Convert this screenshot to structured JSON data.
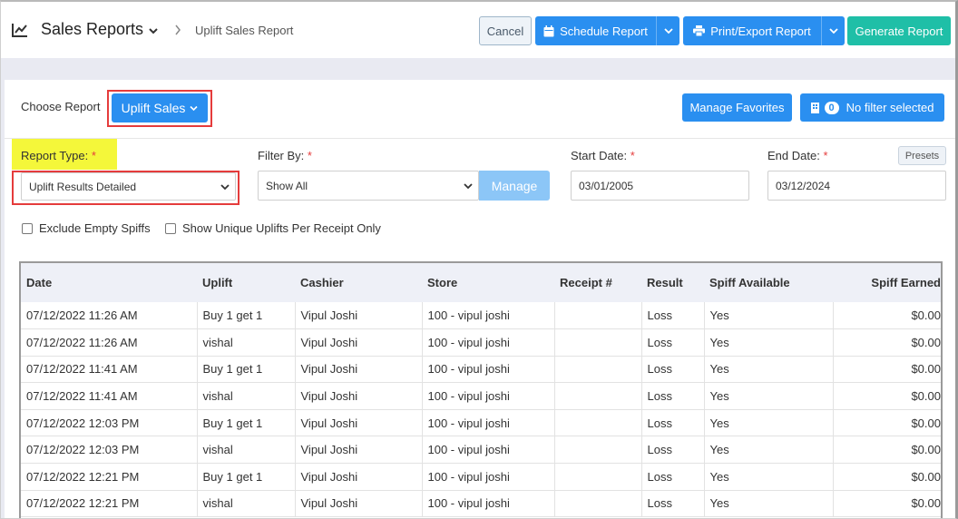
{
  "header": {
    "title": "Sales Reports",
    "breadcrumb": "Uplift Sales Report",
    "icon": "line-chart-icon"
  },
  "toolbar": {
    "cancel_label": "Cancel",
    "schedule_label": "Schedule Report",
    "print_label": "Print/Export Report",
    "generate_label": "Generate Report"
  },
  "report": {
    "choose_label": "Choose Report",
    "selected": "Uplift Sales",
    "manage_favorites": "Manage Favorites",
    "filter_count": "0",
    "filter_text": "No filter selected"
  },
  "filters": {
    "report_type_label": "Report Type:",
    "report_type_value": "Uplift Results Detailed",
    "filter_by_label": "Filter By:",
    "filter_by_value": "Show All",
    "manage_label": "Manage",
    "start_date_label": "Start Date:",
    "start_date_value": "03/01/2005",
    "end_date_label": "End Date:",
    "end_date_value": "03/12/2024",
    "presets_label": "Presets",
    "required_mark": "*",
    "exclude_empty_label": "Exclude Empty Spiffs",
    "unique_uplifts_label": "Show Unique Uplifts Per Receipt Only"
  },
  "table": {
    "columns": [
      "Date",
      "Uplift",
      "Cashier",
      "Store",
      "Receipt #",
      "Result",
      "Spiff Available",
      "Spiff Earned"
    ],
    "rows": [
      [
        "07/12/2022 11:26 AM",
        "Buy 1 get 1",
        "Vipul Joshi",
        "100 - vipul joshi",
        "",
        "Loss",
        "Yes",
        "$0.00"
      ],
      [
        "07/12/2022 11:26 AM",
        "vishal",
        "Vipul Joshi",
        "100 - vipul joshi",
        "",
        "Loss",
        "Yes",
        "$0.00"
      ],
      [
        "07/12/2022 11:41 AM",
        "Buy 1 get 1",
        "Vipul Joshi",
        "100 - vipul joshi",
        "",
        "Loss",
        "Yes",
        "$0.00"
      ],
      [
        "07/12/2022 11:41 AM",
        "vishal",
        "Vipul Joshi",
        "100 - vipul joshi",
        "",
        "Loss",
        "Yes",
        "$0.00"
      ],
      [
        "07/12/2022 12:03 PM",
        "Buy 1 get 1",
        "Vipul Joshi",
        "100 - vipul joshi",
        "",
        "Loss",
        "Yes",
        "$0.00"
      ],
      [
        "07/12/2022 12:03 PM",
        "vishal",
        "Vipul Joshi",
        "100 - vipul joshi",
        "",
        "Loss",
        "Yes",
        "$0.00"
      ],
      [
        "07/12/2022 12:21 PM",
        "Buy 1 get 1",
        "Vipul Joshi",
        "100 - vipul joshi",
        "",
        "Loss",
        "Yes",
        "$0.00"
      ],
      [
        "07/12/2022 12:21 PM",
        "vishal",
        "Vipul Joshi",
        "100 - vipul joshi",
        "",
        "Loss",
        "Yes",
        "$0.00"
      ]
    ]
  },
  "colors": {
    "primary": "#2a8ff0",
    "teal": "#1fbfa7",
    "highlight": "#f4f73a",
    "annotation_red": "#e53c3c"
  }
}
